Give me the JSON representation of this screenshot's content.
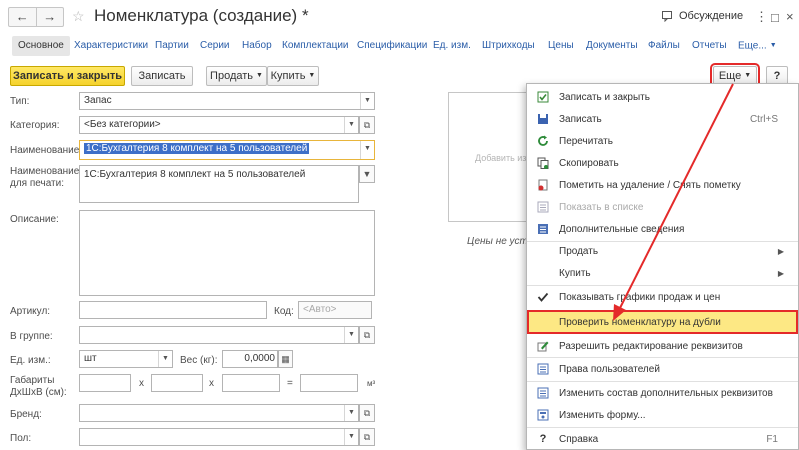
{
  "header": {
    "back_icon": "arrow-left-icon",
    "forward_icon": "arrow-right-icon",
    "title": "Номенклатура (создание) *",
    "discuss_label": "Обсуждение"
  },
  "tabs": [
    "Основное",
    "Характеристики",
    "Партии",
    "Серии",
    "Набор",
    "Комплектации",
    "Спецификации",
    "Ед. изм.",
    "Штрихкоды",
    "Цены",
    "Документы",
    "Файлы",
    "Отчеты",
    "Еще..."
  ],
  "toolbar": {
    "save_close": "Записать и закрыть",
    "save": "Записать",
    "sell": "Продать",
    "buy": "Купить",
    "more": "Еще",
    "help": "?"
  },
  "form": {
    "type_label": "Тип:",
    "type_value": "Запас",
    "category_label": "Категория:",
    "category_value": "<Без категории>",
    "name_label": "Наименование:",
    "name_value": "1С:Бухгалтерия 8 комплект на 5 пользователей",
    "print_name_label": "Наименование для печати:",
    "print_name_value": "1С:Бухгалтерия 8 комплект на 5 пользователей",
    "description_label": "Описание:",
    "article_label": "Артикул:",
    "code_label": "Код:",
    "code_placeholder": "<Авто>",
    "group_label": "В группе:",
    "unit_label": "Ед. изм.:",
    "unit_value": "шт",
    "weight_label": "Вес (кг):",
    "weight_value": "0,0000",
    "dims_label": "Габариты ДхШхВ (см):",
    "dims_x1": "x",
    "dims_x2": "x",
    "dims_eq": "=",
    "dims_unit": "м³",
    "brand_label": "Бренд:",
    "gender_label": "Пол:"
  },
  "picture": {
    "add_image_text": "Добавить из",
    "prices_text": "Цены не уст"
  },
  "menu": {
    "items": [
      {
        "label": "Записать и закрыть",
        "icon": "save-close-icon"
      },
      {
        "label": "Записать",
        "shortcut": "Ctrl+S",
        "icon": "save-icon"
      },
      {
        "label": "Перечитать",
        "icon": "reload-icon"
      },
      {
        "label": "Скопировать",
        "icon": "copy-icon"
      },
      {
        "label": "Пометить на удаление / Снять пометку",
        "icon": "delete-mark-icon"
      },
      {
        "label": "Показать в списке",
        "icon": "list-icon"
      },
      {
        "label": "Дополнительные сведения",
        "icon": "info-list-icon"
      },
      {
        "label": "Продать",
        "icon": "",
        "submenu": true
      },
      {
        "label": "Купить",
        "icon": "",
        "submenu": true
      },
      {
        "label": "Показывать графики продаж и цен",
        "icon": "checkmark-icon"
      },
      {
        "label": "Проверить номенклатуру на дубли",
        "icon": ""
      },
      {
        "label": "Разрешить редактирование реквизитов",
        "icon": "edit-icon"
      },
      {
        "label": "Права пользователей",
        "icon": "users-rights-icon"
      },
      {
        "label": "Изменить состав дополнительных реквизитов",
        "icon": "props-list-icon"
      },
      {
        "label": "Изменить форму...",
        "icon": "form-icon"
      },
      {
        "label": "Справка",
        "shortcut": "F1",
        "icon": "help-icon"
      }
    ]
  },
  "colors": {
    "accent_link": "#2a5da8",
    "primary_button": "#f5d22c",
    "highlight": "#fde884",
    "annotation_red": "#e42a2a"
  }
}
